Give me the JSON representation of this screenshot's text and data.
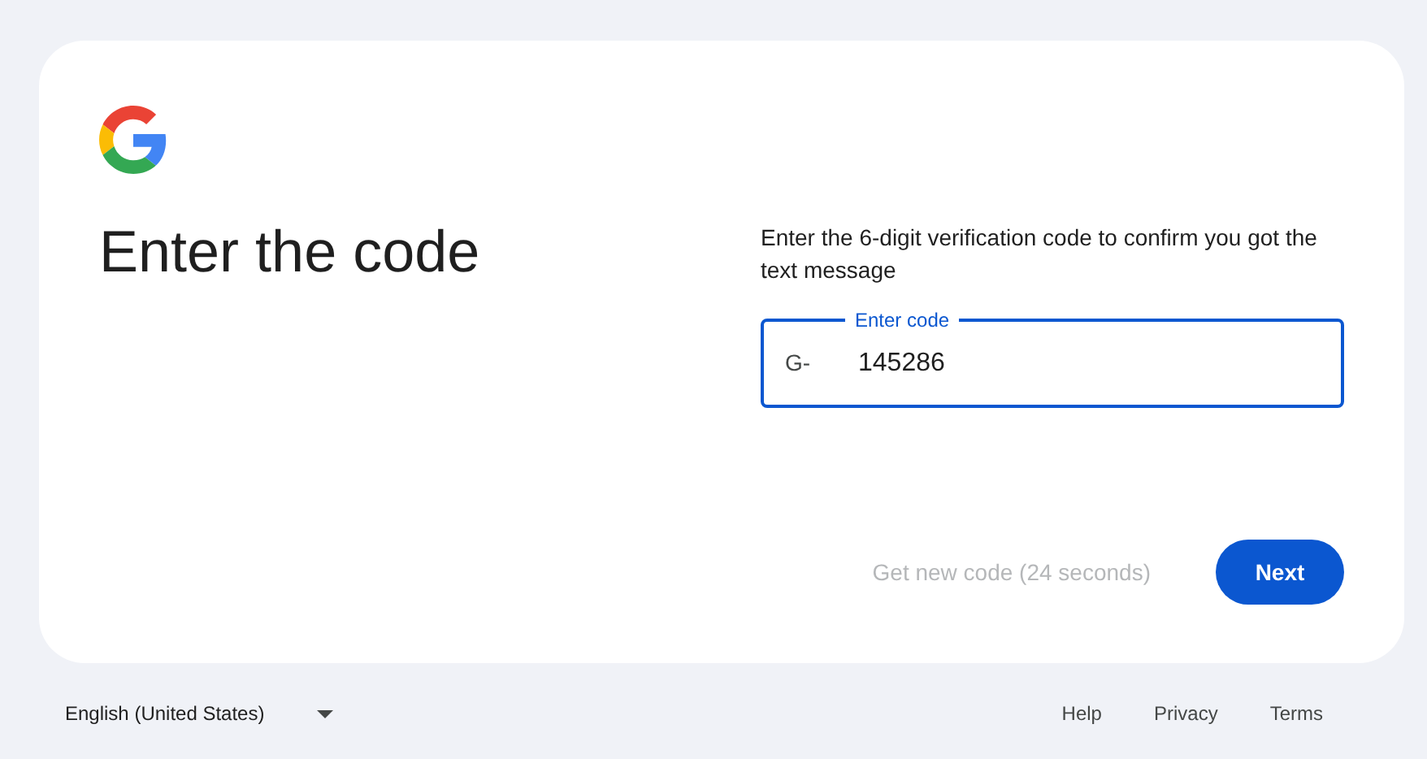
{
  "heading": "Enter the code",
  "instructions": "Enter the 6-digit verification code to confirm you got the text message",
  "code_field": {
    "label": "Enter code",
    "prefix": "G-",
    "value": "145286",
    "focused": true
  },
  "resend": {
    "label": "Get new code (24 seconds)",
    "disabled": true
  },
  "next_button": {
    "label": "Next"
  },
  "footer": {
    "language": "English (United States)",
    "links": [
      "Help",
      "Privacy",
      "Terms"
    ]
  }
}
